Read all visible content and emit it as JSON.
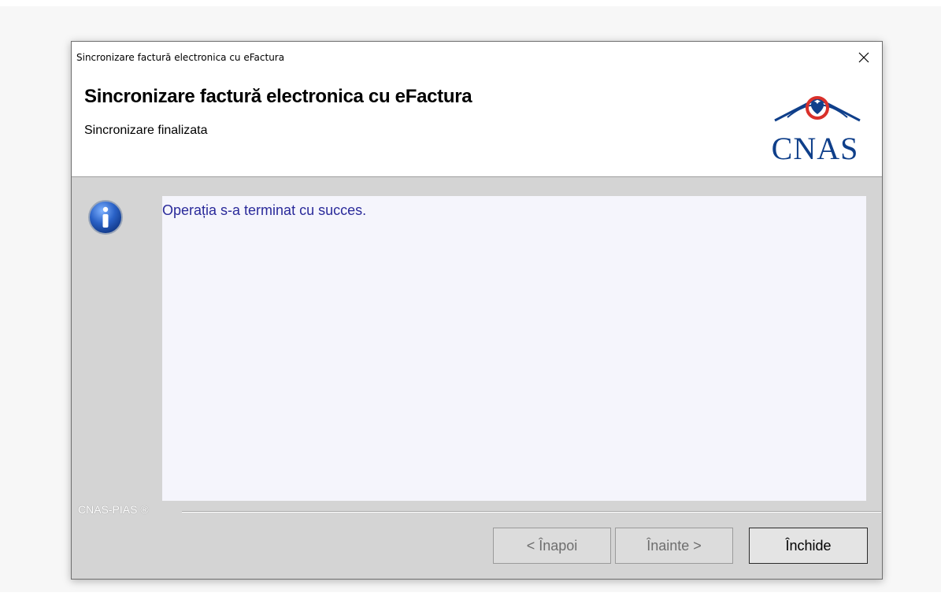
{
  "window": {
    "titlebar_text": "Sincronizare factură electronica cu eFactura",
    "close_label": "×"
  },
  "header": {
    "title": "Sincronizare factură electronica cu eFactura",
    "subtitle": "Sincronizare finalizata",
    "logo_text": "CNAS"
  },
  "body": {
    "message": "Operația s-a terminat cu succes.",
    "icon": "info-icon"
  },
  "footer": {
    "brand": "CNAS-PIAS ®",
    "buttons": {
      "back": "< Înapoi",
      "next": "Înainte >",
      "close": "Închide"
    }
  },
  "colors": {
    "logo_blue": "#0f3f8a",
    "logo_red": "#d9302a",
    "message_text": "#2a2a9a",
    "info_blue": "#1f55b8"
  }
}
